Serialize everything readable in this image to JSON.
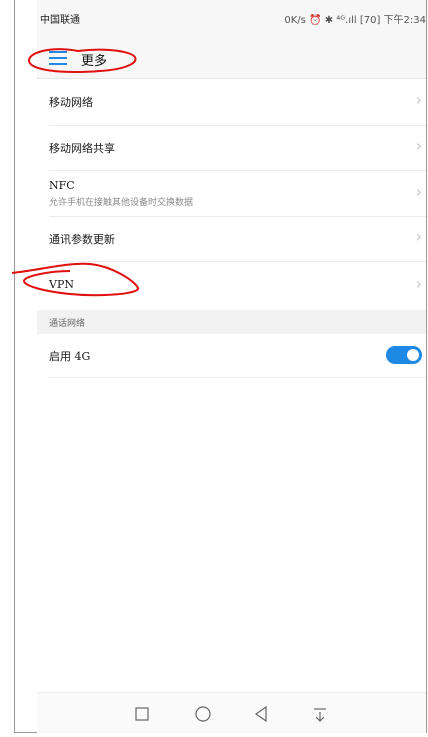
{
  "status_bar": {
    "carrier": "中国联通",
    "right": "0K/s ⏰ ✱ ⁴ᴳ.ıll [70] 下午2:34"
  },
  "header": {
    "title": "更多"
  },
  "items": [
    {
      "label": "移动网络",
      "sub": ""
    },
    {
      "label": "移动网络共享",
      "sub": ""
    },
    {
      "label": "NFC",
      "sub": "允许手机在接触其他设备时交换数据"
    },
    {
      "label": "通讯参数更新",
      "sub": ""
    },
    {
      "label": "VPN",
      "sub": ""
    }
  ],
  "section": {
    "title": "通话网络"
  },
  "toggle_row": {
    "label": "启用 4G",
    "enabled": true
  },
  "colors": {
    "accent": "#1e88e5",
    "annotation": "#e01010"
  },
  "icons": [
    "menu-icon",
    "chevron-right-icon",
    "square-recent-icon",
    "circle-home-icon",
    "triangle-back-icon",
    "notification-down-icon"
  ]
}
